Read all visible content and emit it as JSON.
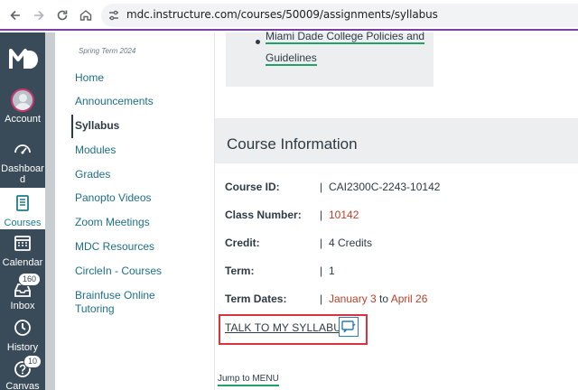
{
  "browser": {
    "url": "mdc.instructure.com/courses/50009/assignments/syllabus"
  },
  "global_nav": {
    "account": "Account",
    "dashboard_line1": "Dashboar",
    "dashboard_line2": "d",
    "courses": "Courses",
    "calendar": "Calendar",
    "inbox": "Inbox",
    "inbox_badge": "160",
    "history": "History",
    "canvas": "Canvas",
    "canvas_badge": "10"
  },
  "course_nav": {
    "term": "Spring Term 2024",
    "items": [
      "Home",
      "Announcements",
      "Syllabus",
      "Modules",
      "Grades",
      "Panopto Videos",
      "Zoom Meetings",
      "MDC Resources",
      "CircleIn - Courses",
      "Brainfuse Online",
      "Tutoring"
    ],
    "active_item": "Syllabus"
  },
  "main": {
    "policy_line1": "Miami Dade College Policies and",
    "policy_line2": "Guidelines",
    "section_title": "Course Information",
    "rows": [
      {
        "label": "Course ID:",
        "sep": "|",
        "value": "CAI2300C-2243-10142"
      },
      {
        "label": "Class Number:",
        "sep": "|",
        "value": "10142"
      },
      {
        "label": "Credit:",
        "sep": "|",
        "value": "4 Credits"
      },
      {
        "label": "Term:",
        "sep": "|",
        "value": "1"
      },
      {
        "label": "Term Dates:",
        "sep": "|",
        "value_start": "January 3",
        "value_mid": " to ",
        "value_end": "April 26"
      }
    ],
    "talk_link": "TALK TO MY SYLLABUS",
    "jump_link": "Jump to MENU"
  },
  "colors": {
    "nav_bg": "#394b58",
    "link": "#1d6f87",
    "red_value": "#b7412a",
    "highlight_frame": "#d9333f",
    "underline_green": "#22a06b"
  }
}
